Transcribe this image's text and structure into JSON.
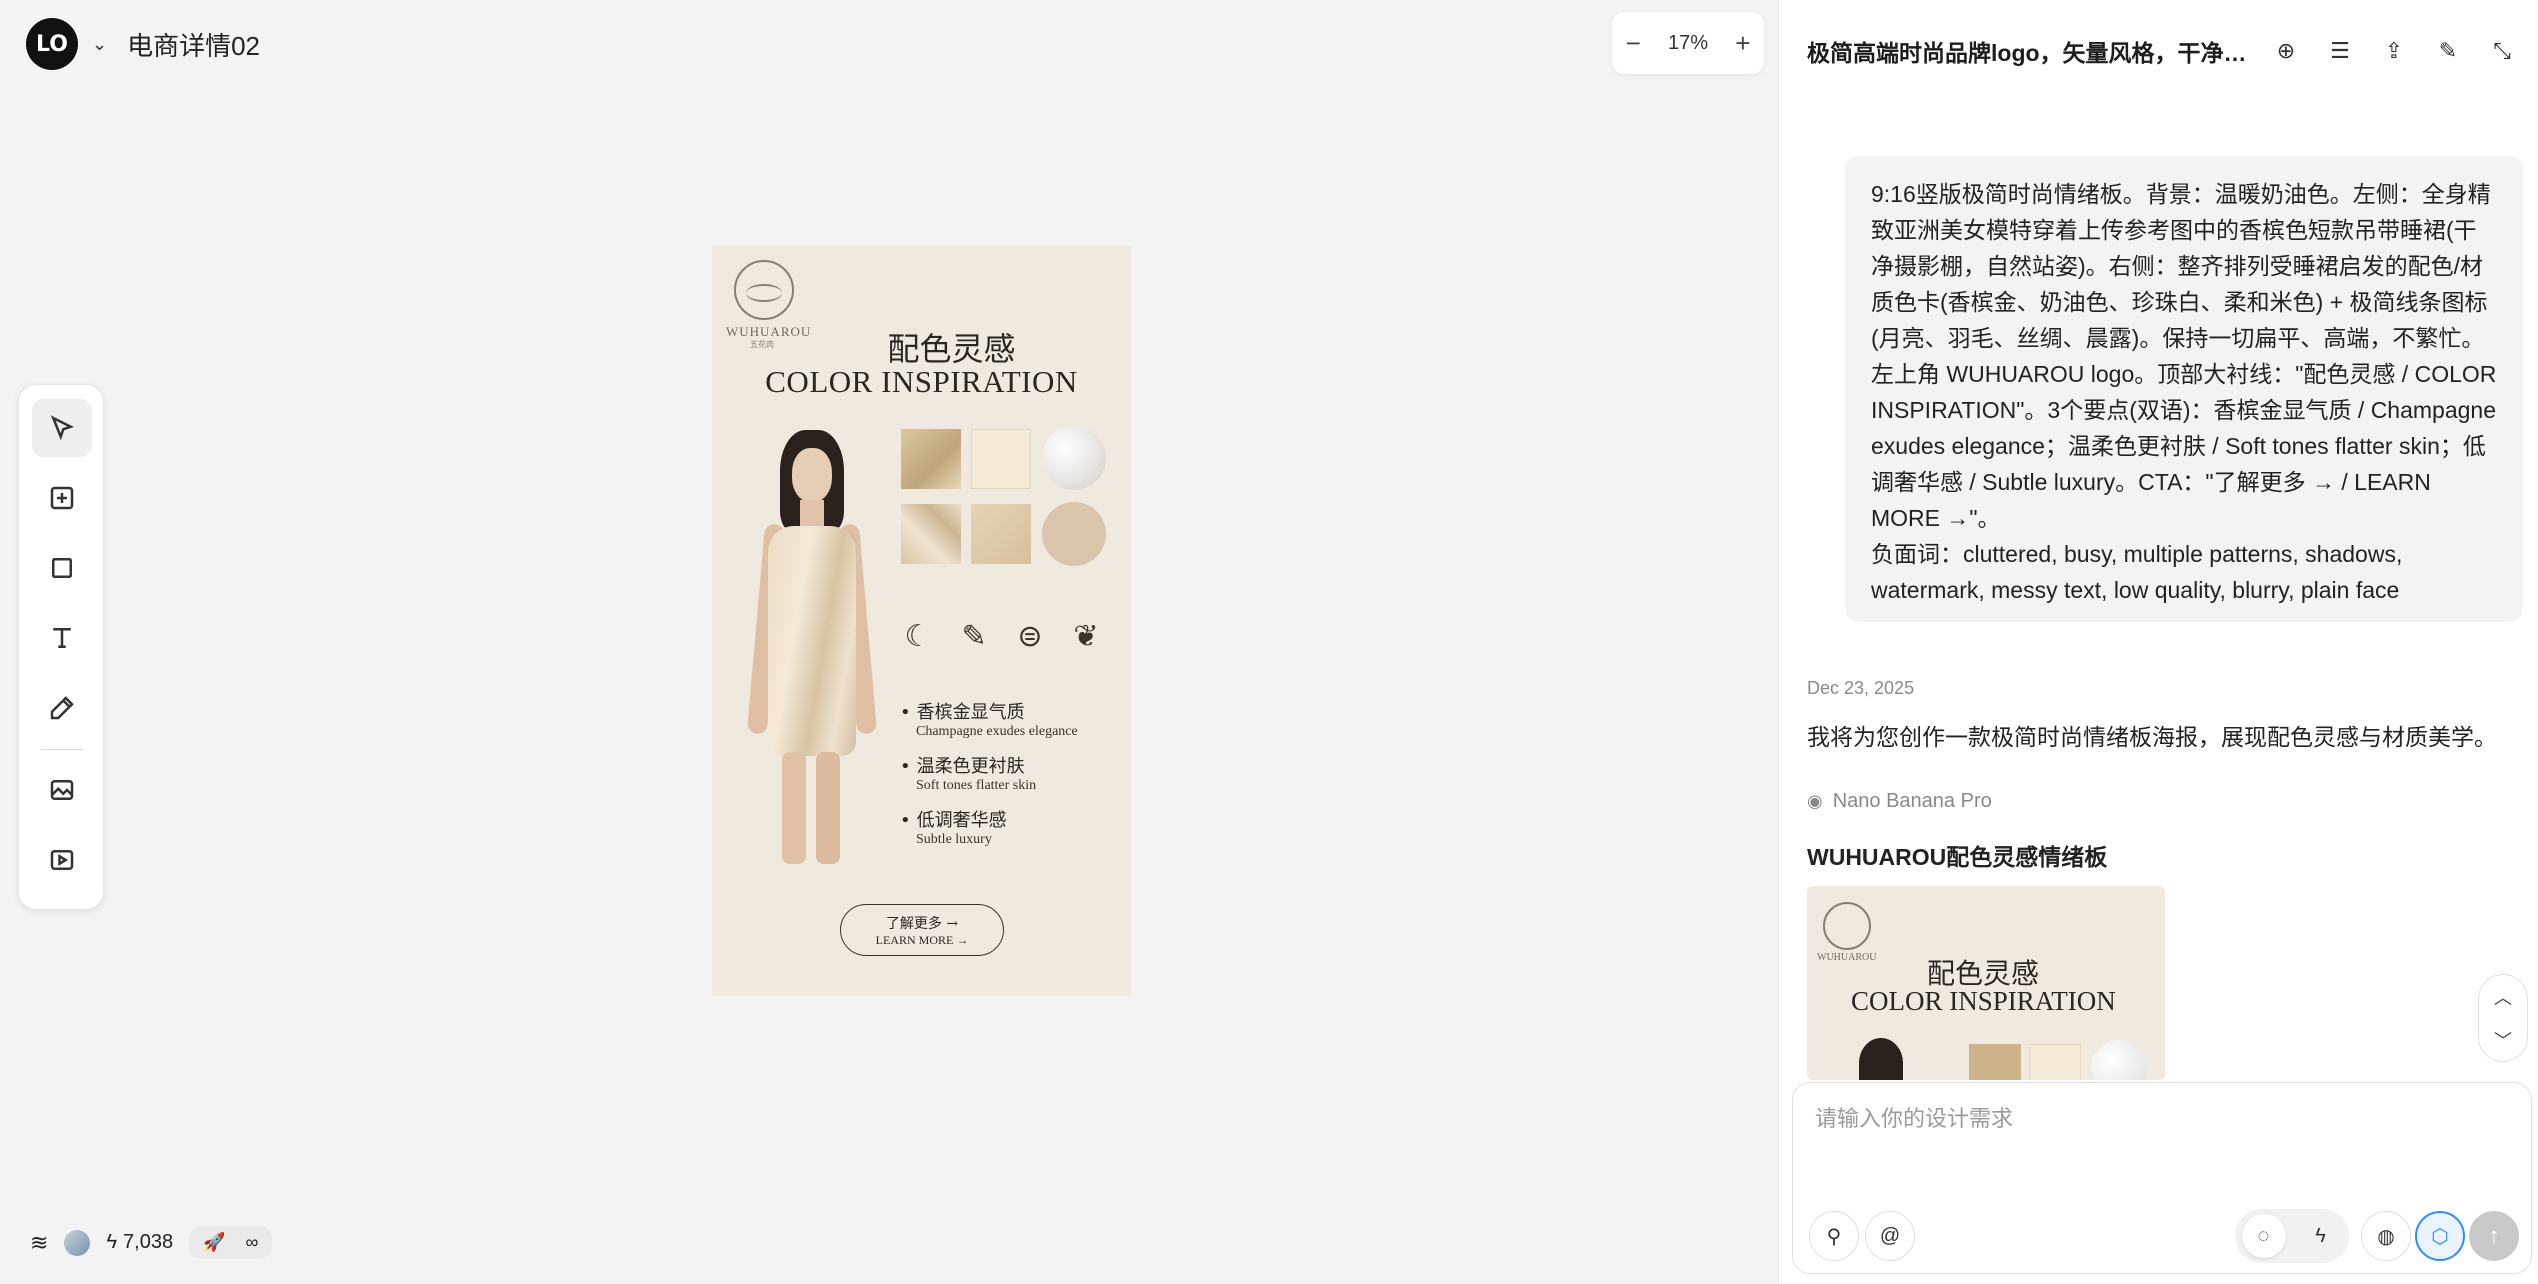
{
  "header": {
    "logo_text": "LO",
    "doc_title": "电商详情02",
    "zoom": "17%",
    "zoom_out": "−",
    "zoom_in": "+"
  },
  "toolbar": {
    "tools": [
      "select-icon",
      "add-frame-icon",
      "rectangle-icon",
      "text-icon",
      "pen-icon",
      "image-gen-icon",
      "video-gen-icon"
    ]
  },
  "artboard": {
    "brand": "WUHUAROU",
    "brand_sub": "五花肉",
    "title_cn": "配色灵感",
    "title_en": "COLOR INSPIRATION",
    "icons": [
      "☾",
      "✎",
      "⊜",
      "❦"
    ],
    "points": [
      {
        "cn": "香槟金显气质",
        "en": "Champagne exudes elegance"
      },
      {
        "cn": "温柔色更衬肤",
        "en": "Soft tones flatter skin"
      },
      {
        "cn": "低调奢华感",
        "en": "Subtle luxury"
      }
    ],
    "cta_cn": "了解更多 →",
    "cta_en": "LEARN MORE →"
  },
  "footer": {
    "credits": "7,038",
    "bolt": "ϟ",
    "rocket": "🚀",
    "infinity": "∞"
  },
  "panel": {
    "title": "极简高端时尚品牌logo，矢量风格，干净…",
    "prompt_lines": [
      "9:16竖版极简时尚情绪板。背景：温暖奶油色。左侧：全身精致亚洲美女模特穿着上传参考图中的香槟色短款吊带睡裙(干净摄影棚，自然站姿)。右侧：整齐排列受睡裙启发的配色/材质色卡(香槟金、奶油色、珍珠白、柔和米色) + 极简线条图标(月亮、羽毛、丝绸、晨露)。保持一切扁平、高端，不繁忙。",
      "左上角 WUHUAROU logo。顶部大衬线：\"配色灵感 / COLOR INSPIRATION\"。3个要点(双语)：香槟金显气质 / Champagne exudes elegance；温柔色更衬肤 / Soft tones flatter skin；低调奢华感 / Subtle luxury。CTA：\"了解更多 → / LEARN MORE →\"。",
      "负面词：cluttered, busy, multiple patterns, shadows, watermark, messy text, low quality, blurry, plain face"
    ],
    "date": "Dec 23, 2025",
    "reply": "我将为您创作一款极简时尚情绪板海报，展现配色灵感与材质美学。",
    "model": "Nano Banana Pro",
    "result_title": "WUHUAROU配色灵感情绪板",
    "thumb_brand": "WUHUAROU",
    "thumb_cn": "配色灵感",
    "thumb_en": "COLOR INSPIRATION",
    "input_placeholder": "请输入你的设计需求"
  }
}
